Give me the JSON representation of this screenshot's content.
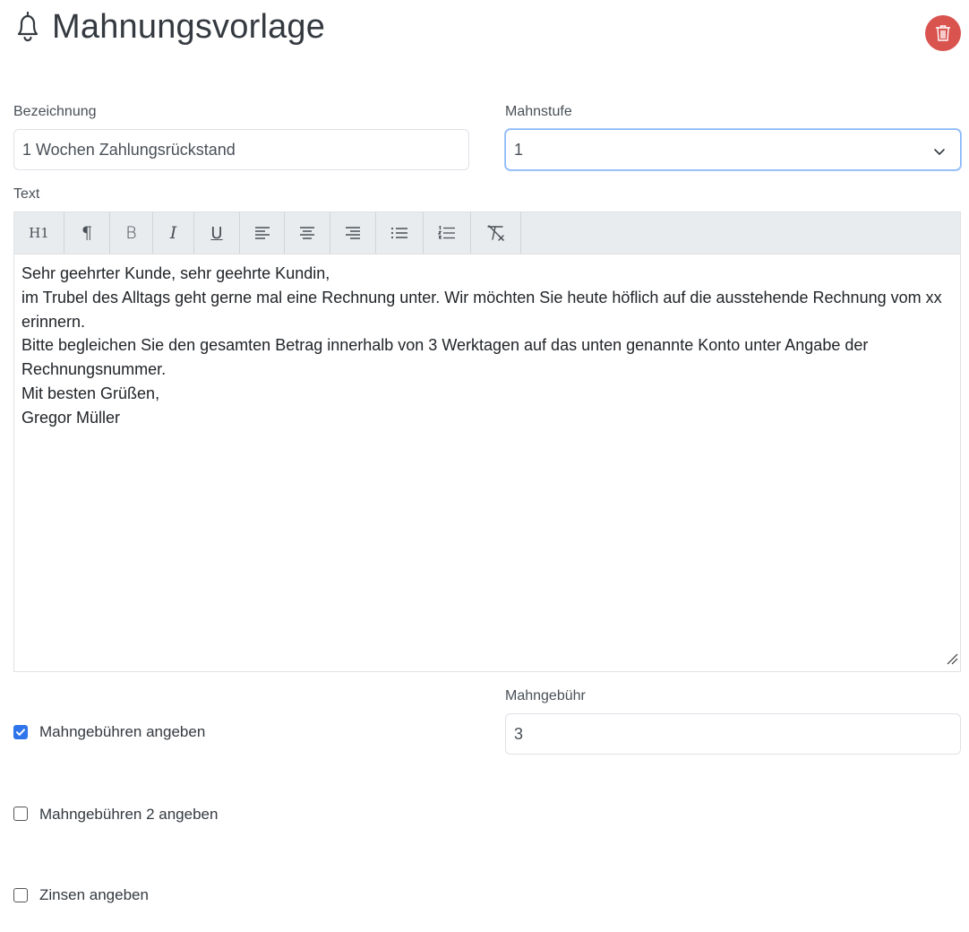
{
  "header": {
    "title": "Mahnungsvorlage",
    "icon": "bell-icon"
  },
  "delete_button": {
    "icon": "trash-icon",
    "color": "#d9534f"
  },
  "form": {
    "bezeichnung": {
      "label": "Bezeichnung",
      "value": "1 Wochen Zahlungsrückstand"
    },
    "mahnstufe": {
      "label": "Mahnstufe",
      "value": "1"
    },
    "text": {
      "label": "Text",
      "toolbar": [
        {
          "name": "heading-button",
          "icon": "H1"
        },
        {
          "name": "paragraph-button",
          "icon": "pilcrow-icon"
        },
        {
          "name": "bold-button",
          "icon": "B"
        },
        {
          "name": "italic-button",
          "icon": "I"
        },
        {
          "name": "underline-button",
          "icon": "U"
        },
        {
          "name": "align-left-button",
          "icon": "align-left-icon"
        },
        {
          "name": "align-center-button",
          "icon": "align-center-icon"
        },
        {
          "name": "align-right-button",
          "icon": "align-right-icon"
        },
        {
          "name": "bullet-list-button",
          "icon": "bullet-list-icon"
        },
        {
          "name": "ordered-list-button",
          "icon": "ordered-list-icon"
        },
        {
          "name": "clear-format-button",
          "icon": "clear-format-icon"
        }
      ],
      "lines": [
        "Sehr geehrter Kunde, sehr geehrte Kundin,",
        "im Trubel des Alltags geht gerne mal eine Rechnung unter. Wir möchten Sie heute höflich auf die ausstehende Rechnung vom xx erinnern.",
        "Bitte begleichen Sie den gesamten Betrag innerhalb von 3 Werktagen auf das unten genannte Konto unter Angabe der Rechnungsnummer.",
        "Mit besten Grüßen,",
        "Gregor Müller"
      ]
    },
    "mahngebuehren": {
      "label": "Mahngebühren angeben",
      "checked": true
    },
    "mahngebuehr": {
      "label": "Mahngebühr",
      "value": "3"
    },
    "mahngebuehren2": {
      "label": "Mahngebühren 2 angeben",
      "checked": false
    },
    "zinsen": {
      "label": "Zinsen angeben",
      "checked": false
    }
  },
  "colors": {
    "accent": "#2f74ea",
    "danger": "#d9534f",
    "toolbar_bg": "#e9ecef"
  }
}
